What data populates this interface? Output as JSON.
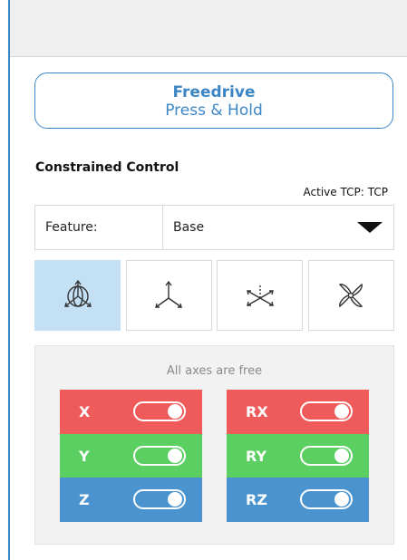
{
  "freedrive": {
    "line1": "Freedrive",
    "line2": "Press & Hold"
  },
  "constrained": {
    "title": "Constrained Control",
    "active_tcp_label": "Active TCP:",
    "active_tcp_value": "TCP"
  },
  "feature": {
    "label": "Feature:",
    "selected": "Base"
  },
  "modes": [
    {
      "icon": "free-axes-icon",
      "active": true
    },
    {
      "icon": "plane-axes-icon",
      "active": false
    },
    {
      "icon": "translation-axes-icon",
      "active": false
    },
    {
      "icon": "rotation-icon",
      "active": false
    }
  ],
  "axes_panel": {
    "message": "All axes are free",
    "left": [
      {
        "name": "X",
        "enabled": true,
        "color": "#ef5b5b"
      },
      {
        "name": "Y",
        "enabled": true,
        "color": "#5ccf63"
      },
      {
        "name": "Z",
        "enabled": true,
        "color": "#4a93cf"
      }
    ],
    "right": [
      {
        "name": "RX",
        "enabled": true,
        "color": "#ef5b5b"
      },
      {
        "name": "RY",
        "enabled": true,
        "color": "#5ccf63"
      },
      {
        "name": "RZ",
        "enabled": true,
        "color": "#4a93cf"
      }
    ]
  },
  "colors": {
    "accent": "#3d86c6",
    "active_mode": "#c4e0f5"
  }
}
